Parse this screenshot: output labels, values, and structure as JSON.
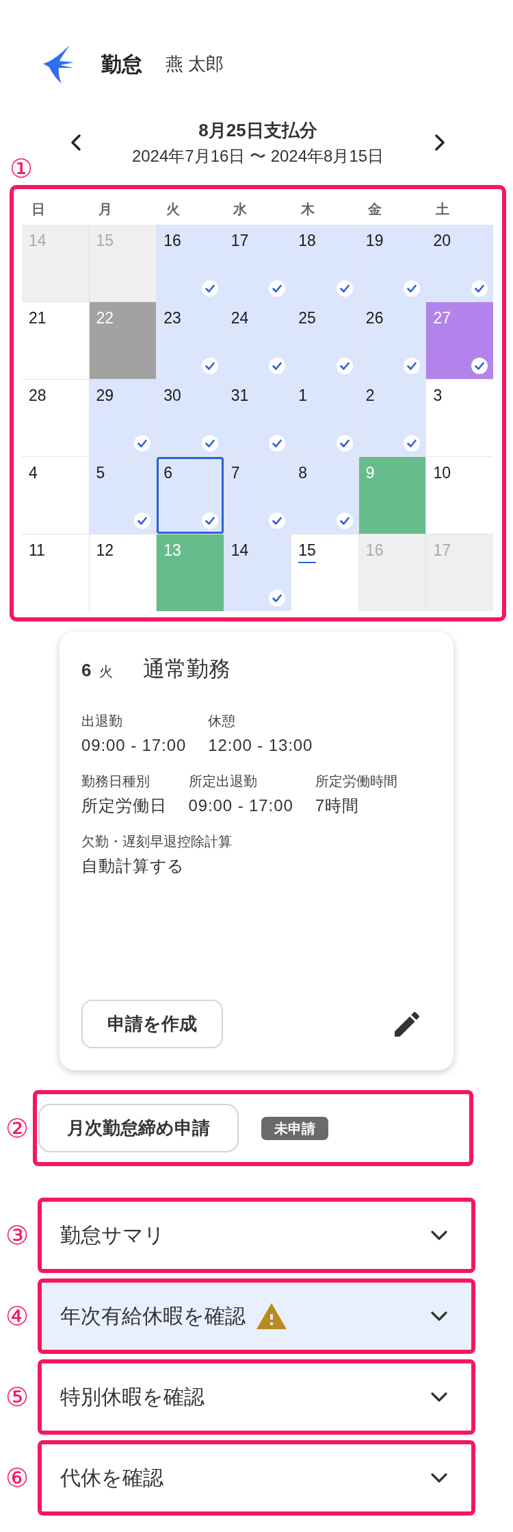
{
  "header": {
    "app_title": "勤怠",
    "user_name": "燕 太郎"
  },
  "period": {
    "title": "8月25日支払分",
    "range": "2024年7月16日 〜 2024年8月15日"
  },
  "calendar": {
    "callout": "①",
    "weekdays": [
      "日",
      "月",
      "火",
      "水",
      "木",
      "金",
      "土"
    ],
    "weeks": [
      {
        "days": [
          {
            "day": "14",
            "color": "#efefef",
            "outside": true,
            "checked": false,
            "selected": false,
            "today": false
          },
          {
            "day": "15",
            "color": "#efefef",
            "outside": true,
            "checked": false,
            "selected": false,
            "today": false
          },
          {
            "day": "16",
            "color": "#dbe6fd",
            "outside": false,
            "checked": true,
            "selected": false,
            "today": false
          },
          {
            "day": "17",
            "color": "#dbe6fd",
            "outside": false,
            "checked": true,
            "selected": false,
            "today": false
          },
          {
            "day": "18",
            "color": "#dbe6fd",
            "outside": false,
            "checked": true,
            "selected": false,
            "today": false
          },
          {
            "day": "19",
            "color": "#dbe6fd",
            "outside": false,
            "checked": true,
            "selected": false,
            "today": false
          },
          {
            "day": "20",
            "color": "#dbe6fd",
            "outside": false,
            "checked": true,
            "selected": false,
            "today": false
          }
        ]
      },
      {
        "days": [
          {
            "day": "21",
            "color": "#ffffff",
            "outside": false,
            "checked": false,
            "selected": false,
            "today": false
          },
          {
            "day": "22",
            "color": "#a2a2a2",
            "outside": false,
            "checked": false,
            "selected": false,
            "today": false
          },
          {
            "day": "23",
            "color": "#dbe6fd",
            "outside": false,
            "checked": true,
            "selected": false,
            "today": false
          },
          {
            "day": "24",
            "color": "#dbe6fd",
            "outside": false,
            "checked": true,
            "selected": false,
            "today": false
          },
          {
            "day": "25",
            "color": "#dbe6fd",
            "outside": false,
            "checked": true,
            "selected": false,
            "today": false
          },
          {
            "day": "26",
            "color": "#dbe6fd",
            "outside": false,
            "checked": true,
            "selected": false,
            "today": false
          },
          {
            "day": "27",
            "color": "#b383ec",
            "outside": false,
            "checked": true,
            "selected": false,
            "today": false
          }
        ]
      },
      {
        "days": [
          {
            "day": "28",
            "color": "#ffffff",
            "outside": false,
            "checked": false,
            "selected": false,
            "today": false
          },
          {
            "day": "29",
            "color": "#dbe6fd",
            "outside": false,
            "checked": true,
            "selected": false,
            "today": false
          },
          {
            "day": "30",
            "color": "#dbe6fd",
            "outside": false,
            "checked": true,
            "selected": false,
            "today": false
          },
          {
            "day": "31",
            "color": "#dbe6fd",
            "outside": false,
            "checked": true,
            "selected": false,
            "today": false
          },
          {
            "day": "1",
            "color": "#dbe6fd",
            "outside": false,
            "checked": true,
            "selected": false,
            "today": false
          },
          {
            "day": "2",
            "color": "#dbe6fd",
            "outside": false,
            "checked": true,
            "selected": false,
            "today": false
          },
          {
            "day": "3",
            "color": "#ffffff",
            "outside": false,
            "checked": false,
            "selected": false,
            "today": false
          }
        ]
      },
      {
        "days": [
          {
            "day": "4",
            "color": "#ffffff",
            "outside": false,
            "checked": false,
            "selected": false,
            "today": false
          },
          {
            "day": "5",
            "color": "#dbe6fd",
            "outside": false,
            "checked": true,
            "selected": false,
            "today": false
          },
          {
            "day": "6",
            "color": "#dbe6fd",
            "outside": false,
            "checked": true,
            "selected": true,
            "today": false
          },
          {
            "day": "7",
            "color": "#dbe6fd",
            "outside": false,
            "checked": true,
            "selected": false,
            "today": false
          },
          {
            "day": "8",
            "color": "#dbe6fd",
            "outside": false,
            "checked": true,
            "selected": false,
            "today": false
          },
          {
            "day": "9",
            "color": "#66bd8b",
            "outside": false,
            "checked": false,
            "selected": false,
            "today": false
          },
          {
            "day": "10",
            "color": "#ffffff",
            "outside": false,
            "checked": false,
            "selected": false,
            "today": false
          }
        ]
      },
      {
        "days": [
          {
            "day": "11",
            "color": "#ffffff",
            "outside": false,
            "checked": false,
            "selected": false,
            "today": false
          },
          {
            "day": "12",
            "color": "#ffffff",
            "outside": false,
            "checked": false,
            "selected": false,
            "today": false
          },
          {
            "day": "13",
            "color": "#66bd8b",
            "outside": false,
            "checked": false,
            "selected": false,
            "today": false
          },
          {
            "day": "14",
            "color": "#dbe6fd",
            "outside": false,
            "checked": true,
            "selected": false,
            "today": false
          },
          {
            "day": "15",
            "color": "#ffffff",
            "outside": false,
            "checked": false,
            "selected": false,
            "today": true
          },
          {
            "day": "16",
            "color": "#efefef",
            "outside": true,
            "checked": false,
            "selected": false,
            "today": false
          },
          {
            "day": "17",
            "color": "#efefef",
            "outside": true,
            "checked": false,
            "selected": false,
            "today": false
          }
        ]
      }
    ]
  },
  "day_detail": {
    "day": "6",
    "weekday": "火",
    "title": "通常勤務",
    "field_rows": [
      [
        {
          "label": "出退勤",
          "value": "09:00 - 17:00"
        },
        {
          "label": "休憩",
          "value": "12:00 - 13:00"
        }
      ],
      [
        {
          "label": "勤務日種別",
          "value": "所定労働日"
        },
        {
          "label": "所定出退勤",
          "value": "09:00 - 17:00"
        },
        {
          "label": "所定労働時間",
          "value": "7時間"
        }
      ],
      [
        {
          "label": "欠勤・遅刻早退控除計算",
          "value": "自動計算する"
        }
      ]
    ],
    "create_button": "申請を作成"
  },
  "monthly_closing": {
    "callout": "②",
    "button": "月次勤怠締め申請",
    "status": "未申請"
  },
  "accordions": [
    {
      "callout": "③",
      "label": "勤怠サマリ",
      "highlighted": false,
      "warning": false,
      "expanded": false
    },
    {
      "callout": "④",
      "label": "年次有給休暇を確認",
      "highlighted": true,
      "warning": true,
      "expanded": false
    },
    {
      "callout": "⑤",
      "label": "特別休暇を確認",
      "highlighted": false,
      "warning": false,
      "expanded": false
    },
    {
      "callout": "⑥",
      "label": "代休を確認",
      "highlighted": false,
      "warning": false,
      "expanded": false
    }
  ]
}
